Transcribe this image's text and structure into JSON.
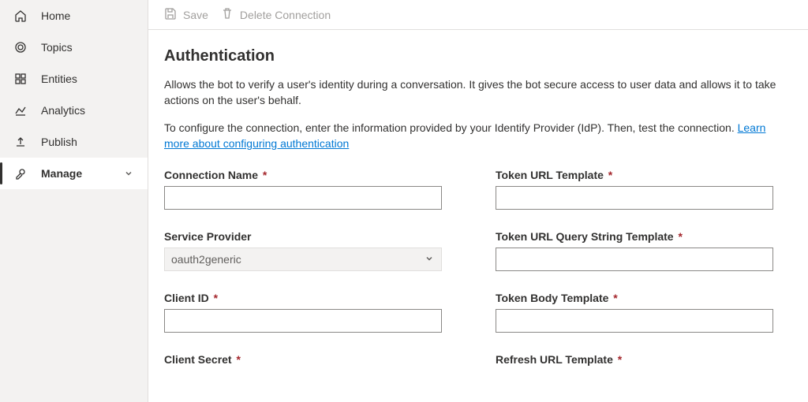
{
  "sidebar": {
    "items": [
      {
        "label": "Home"
      },
      {
        "label": "Topics"
      },
      {
        "label": "Entities"
      },
      {
        "label": "Analytics"
      },
      {
        "label": "Publish"
      },
      {
        "label": "Manage"
      }
    ]
  },
  "toolbar": {
    "save_label": "Save",
    "delete_label": "Delete Connection"
  },
  "page": {
    "title": "Authentication",
    "desc1": "Allows the bot to verify a user's identity during a conversation. It gives the bot secure access to user data and allows it to take actions on the user's behalf.",
    "desc2_prefix": "To configure the connection, enter the information provided by your Identify Provider (IdP). Then, test the connection. ",
    "learn_more": "Learn more about configuring authentication"
  },
  "form": {
    "connection_name": {
      "label": "Connection Name",
      "value": ""
    },
    "service_provider": {
      "label": "Service Provider",
      "value": "oauth2generic"
    },
    "client_id": {
      "label": "Client ID",
      "value": ""
    },
    "client_secret": {
      "label": "Client Secret",
      "value": ""
    },
    "token_url_template": {
      "label": "Token URL Template",
      "value": ""
    },
    "token_url_query": {
      "label": "Token URL Query String Template",
      "value": ""
    },
    "token_body": {
      "label": "Token Body Template",
      "value": ""
    },
    "refresh_url": {
      "label": "Refresh URL Template",
      "value": ""
    }
  }
}
